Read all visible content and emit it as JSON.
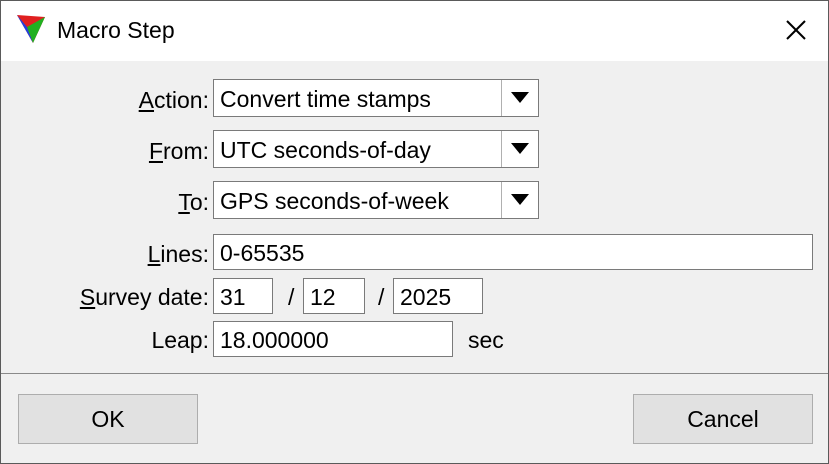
{
  "window": {
    "title": "Macro Step"
  },
  "form": {
    "action": {
      "label_key": "A",
      "label_rest": "ction:",
      "value": "Convert time stamps"
    },
    "from": {
      "label_key": "F",
      "label_rest": "rom:",
      "value": "UTC seconds-of-day"
    },
    "to": {
      "label_key": "T",
      "label_rest": "o:",
      "value": "GPS seconds-of-week"
    },
    "lines": {
      "label_key": "L",
      "label_rest": "ines:",
      "value": "0-65535"
    },
    "survey_date": {
      "label_key": "S",
      "label_rest": "urvey date:",
      "day": "31",
      "month": "12",
      "year": "2025",
      "separator": "/"
    },
    "leap": {
      "label": "Leap:",
      "value": "18.000000",
      "unit": "sec"
    }
  },
  "buttons": {
    "ok": "OK",
    "cancel": "Cancel"
  },
  "icons": {
    "app": "app-triangle-icon",
    "close": "close-icon",
    "dropdown": "chevron-down-icon"
  }
}
